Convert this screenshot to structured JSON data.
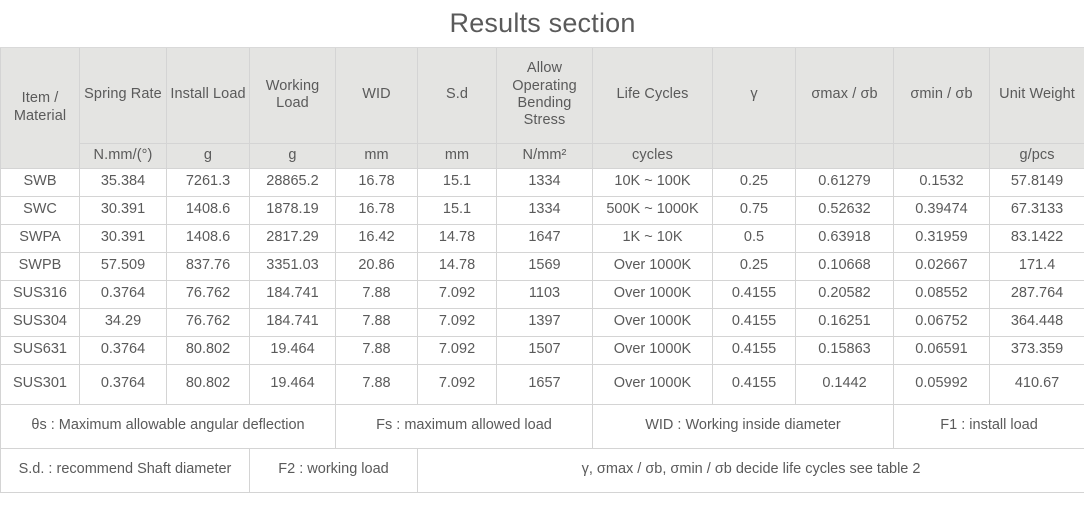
{
  "title": "Results section",
  "columns": [
    {
      "label": "Item / Material",
      "unit": ""
    },
    {
      "label": "Spring Rate",
      "unit": "N.mm/(°)"
    },
    {
      "label": "Install Load",
      "unit": "g"
    },
    {
      "label": "Working Load",
      "unit": "g"
    },
    {
      "label": "WID",
      "unit": "mm"
    },
    {
      "label": "S.d",
      "unit": "mm"
    },
    {
      "label": "Allow Operating Bending Stress",
      "unit": "N/mm²"
    },
    {
      "label": "Life Cycles",
      "unit": "cycles"
    },
    {
      "label": "γ",
      "unit": ""
    },
    {
      "label": "σmax / σb",
      "unit": ""
    },
    {
      "label": "σmin / σb",
      "unit": ""
    },
    {
      "label": "Unit Weight",
      "unit": "g/pcs"
    }
  ],
  "rows": [
    {
      "material": "SWB",
      "spring_rate": "35.384",
      "install_load": "7261.3",
      "working_load": "28865.2",
      "wid": "16.78",
      "sd": "15.1",
      "bending_stress": "1334",
      "life_cycles": "10K ~ 100K",
      "gamma": "0.25",
      "smax_sb": "0.61279",
      "smin_sb": "0.1532",
      "unit_weight": "57.8149",
      "tall": false
    },
    {
      "material": "SWC",
      "spring_rate": "30.391",
      "install_load": "1408.6",
      "working_load": "1878.19",
      "wid": "16.78",
      "sd": "15.1",
      "bending_stress": "1334",
      "life_cycles": "500K ~ 1000K",
      "gamma": "0.75",
      "smax_sb": "0.52632",
      "smin_sb": "0.39474",
      "unit_weight": "67.3133",
      "tall": false
    },
    {
      "material": "SWPA",
      "spring_rate": "30.391",
      "install_load": "1408.6",
      "working_load": "2817.29",
      "wid": "16.42",
      "sd": "14.78",
      "bending_stress": "1647",
      "life_cycles": "1K ~ 10K",
      "gamma": "0.5",
      "smax_sb": "0.63918",
      "smin_sb": "0.31959",
      "unit_weight": "83.1422",
      "tall": false
    },
    {
      "material": "SWPB",
      "spring_rate": "57.509",
      "install_load": "837.76",
      "working_load": "3351.03",
      "wid": "20.86",
      "sd": "14.78",
      "bending_stress": "1569",
      "life_cycles": "Over 1000K",
      "gamma": "0.25",
      "smax_sb": "0.10668",
      "smin_sb": "0.02667",
      "unit_weight": "171.4",
      "tall": false
    },
    {
      "material": "SUS316",
      "spring_rate": "0.3764",
      "install_load": "76.762",
      "working_load": "184.741",
      "wid": "7.88",
      "sd": "7.092",
      "bending_stress": "1103",
      "life_cycles": "Over 1000K",
      "gamma": "0.4155",
      "smax_sb": "0.20582",
      "smin_sb": "0.08552",
      "unit_weight": "287.764",
      "tall": false
    },
    {
      "material": "SUS304",
      "spring_rate": "34.29",
      "install_load": "76.762",
      "working_load": "184.741",
      "wid": "7.88",
      "sd": "7.092",
      "bending_stress": "1397",
      "life_cycles": "Over 1000K",
      "gamma": "0.4155",
      "smax_sb": "0.16251",
      "smin_sb": "0.06752",
      "unit_weight": "364.448",
      "tall": false
    },
    {
      "material": "SUS631",
      "spring_rate": "0.3764",
      "install_load": "80.802",
      "working_load": "19.464",
      "wid": "7.88",
      "sd": "7.092",
      "bending_stress": "1507",
      "life_cycles": "Over 1000K",
      "gamma": "0.4155",
      "smax_sb": "0.15863",
      "smin_sb": "0.06591",
      "unit_weight": "373.359",
      "tall": false
    },
    {
      "material": "SUS301",
      "spring_rate": "0.3764",
      "install_load": "80.802",
      "working_load": "19.464",
      "wid": "7.88",
      "sd": "7.092",
      "bending_stress": "1657",
      "life_cycles": "Over 1000K",
      "gamma": "0.4155",
      "smax_sb": "0.1442",
      "smin_sb": "0.05992",
      "unit_weight": "410.67",
      "tall": true
    }
  ],
  "notes": {
    "row1": [
      "θs : Maximum allowable angular deflection",
      "Fs : maximum allowed load",
      "WID : Working inside diameter",
      "F1 : install load"
    ],
    "row2": [
      "S.d. : recommend Shaft diameter",
      "F2 : working load",
      "γ, σmax / σb, σmin / σb decide life cycles see table 2"
    ]
  },
  "colors": {
    "header_bg": "#e4e4e2",
    "text": "#5a5a5a",
    "border": "#d4d4d4",
    "page_bg": "#ffffff"
  }
}
